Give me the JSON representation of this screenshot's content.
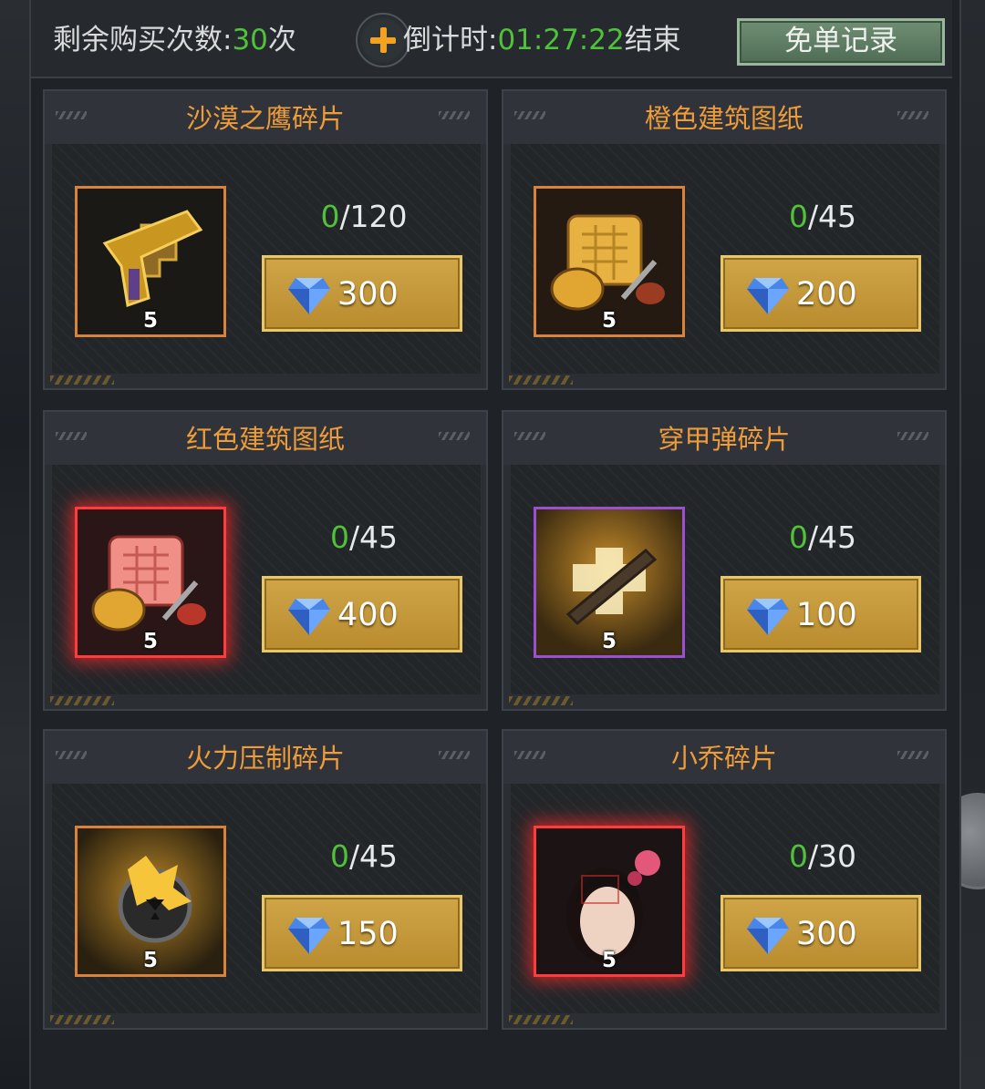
{
  "topbar": {
    "remaining_label": "剩余购买次数:",
    "remaining_count": "30",
    "remaining_unit": "次",
    "countdown_label": "倒计时:",
    "countdown_time": "01:27:22",
    "countdown_suffix": "结束",
    "record_button": "免单记录"
  },
  "items": [
    {
      "title": "沙漠之鹰碎片",
      "owned": "0",
      "progress_rest": "/120",
      "price": "300",
      "quantity": "5",
      "icon": "desert-eagle-pistol-icon",
      "rarity_color": "#d8823a"
    },
    {
      "title": "橙色建筑图纸",
      "owned": "0",
      "progress_rest": "/45",
      "price": "200",
      "quantity": "5",
      "icon": "orange-blueprint-icon",
      "rarity_color": "#d8823a"
    },
    {
      "title": "红色建筑图纸",
      "owned": "0",
      "progress_rest": "/45",
      "price": "400",
      "quantity": "5",
      "icon": "red-blueprint-icon",
      "rarity_color": "#ff3b3b"
    },
    {
      "title": "穿甲弹碎片",
      "owned": "0",
      "progress_rest": "/45",
      "price": "100",
      "quantity": "5",
      "icon": "armor-piercing-bullet-icon",
      "rarity_color": "#9b4fd2"
    },
    {
      "title": "火力压制碎片",
      "owned": "0",
      "progress_rest": "/45",
      "price": "150",
      "quantity": "5",
      "icon": "fire-suppression-icon",
      "rarity_color": "#d8823a"
    },
    {
      "title": "小乔碎片",
      "owned": "0",
      "progress_rest": "/30",
      "price": "300",
      "quantity": "5",
      "icon": "xiaoqiao-portrait-icon",
      "rarity_color": "#ff3b3b"
    }
  ],
  "currency_icon": "diamond-gem-icon",
  "colors": {
    "accent_green": "#4fc23a",
    "title_orange": "#ee9c3a",
    "button_gold": "#cfa548"
  }
}
